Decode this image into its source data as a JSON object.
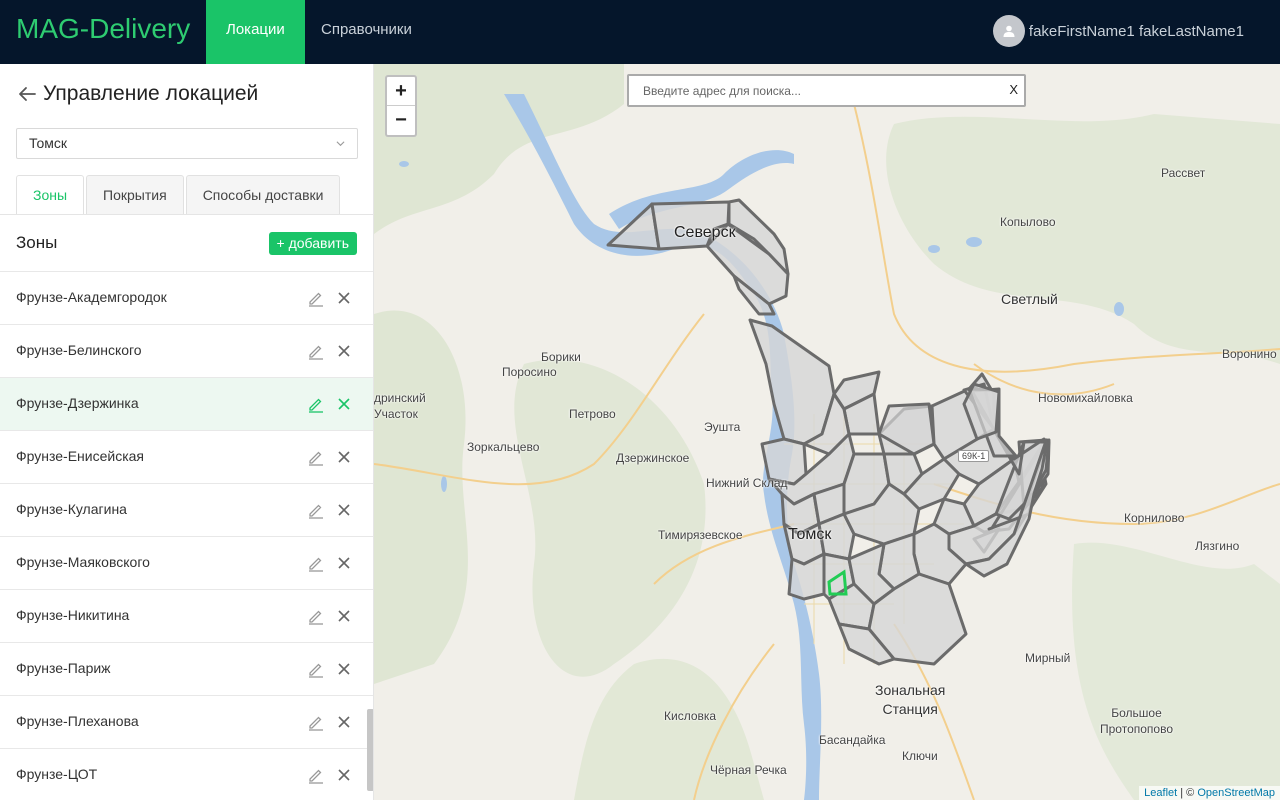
{
  "header": {
    "logo": "MAG-Delivery",
    "nav": [
      {
        "label": "Локации",
        "active": true
      },
      {
        "label": "Справочники",
        "active": false
      }
    ],
    "user_name": "fakeFirstName1 fakeLastName1"
  },
  "sidebar": {
    "title": "Управление локацией",
    "city_selected": "Томск",
    "tabs": [
      {
        "label": "Зоны",
        "active": true
      },
      {
        "label": "Покрытия",
        "active": false
      },
      {
        "label": "Способы доставки",
        "active": false
      }
    ],
    "zones_title": "Зоны",
    "add_label": "+ добавить",
    "zones": [
      "Фрунзе-Академгородок",
      "Фрунзе-Белинского",
      "Фрунзе-Дзержинка",
      "Фрунзе-Енисейская",
      "Фрунзе-Кулагина",
      "Фрунзе-Маяковского",
      "Фрунзе-Никитина",
      "Фрунзе-Париж",
      "Фрунзе-Плеханова",
      "Фрунзе-ЦОТ"
    ],
    "selected_zone": "Фрунзе-Дзержинка"
  },
  "map": {
    "search_placeholder": "Введите адрес для поиска...",
    "clear_label": "X",
    "zoom_in": "+",
    "zoom_out": "−",
    "places": {
      "seversk": "Северск",
      "tomsk": "Томск",
      "rassvet": "Рассвет",
      "kopylovo": "Копылово",
      "svetly": "Светлый",
      "voronino": "Воронино",
      "boriki": "Борики",
      "porosino": "Поросино",
      "uchastok": "дринский\nУчасток",
      "petrovo": "Петрово",
      "eushta": "Эушта",
      "novomikhaylovka": "Новомихайловка",
      "zorkaltsevo": "Зоркальцево",
      "dzerzhinskoe": "Дзержинское",
      "nizhny_sklad": "Нижний Склад",
      "kornilovo": "Корнилово",
      "timiryazevskoe": "Тимирязевское",
      "lyazgino": "Лязгино",
      "mirny": "Мирный",
      "zonalnaya": "Зональная\nСтанция",
      "bolshoe_protopopovo": "Большое\nПротопопово",
      "kislovka": "Кисловка",
      "basandayka": "Басандайка",
      "klyuchi": "Ключи",
      "chernaya_rechka": "Чёрная Речка"
    },
    "road_badge": "69К-1",
    "attribution_leaflet": "Leaflet",
    "attribution_sep": " | © ",
    "attribution_osm": "OpenStreetMap"
  },
  "colors": {
    "accent": "#1ac468",
    "topbar": "#05162b",
    "zone_fill": "#d6d6d6",
    "zone_stroke": "#6b6b6b",
    "selected_zone": "#22cc55"
  }
}
